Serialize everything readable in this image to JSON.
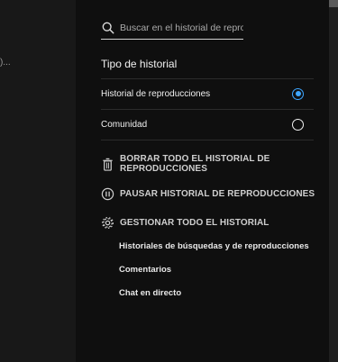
{
  "left_pane": {
    "truncated_text": ")..."
  },
  "search": {
    "placeholder": "Buscar en el historial de reproducciones"
  },
  "history_type": {
    "title": "Tipo de historial",
    "options": [
      {
        "label": "Historial de reproducciones",
        "selected": true
      },
      {
        "label": "Comunidad",
        "selected": false
      }
    ]
  },
  "actions": {
    "clear_all": "BORRAR TODO EL HISTORIAL DE REPRODUCCIONES",
    "pause": "PAUSAR HISTORIAL DE REPRODUCCIONES",
    "manage": "GESTIONAR TODO EL HISTORIAL"
  },
  "manage_links": [
    "Historiales de búsquedas y de reproducciones",
    "Comentarios",
    "Chat en directo"
  ],
  "colors": {
    "accent": "#3ea6ff",
    "background": "#0f0f0f"
  }
}
